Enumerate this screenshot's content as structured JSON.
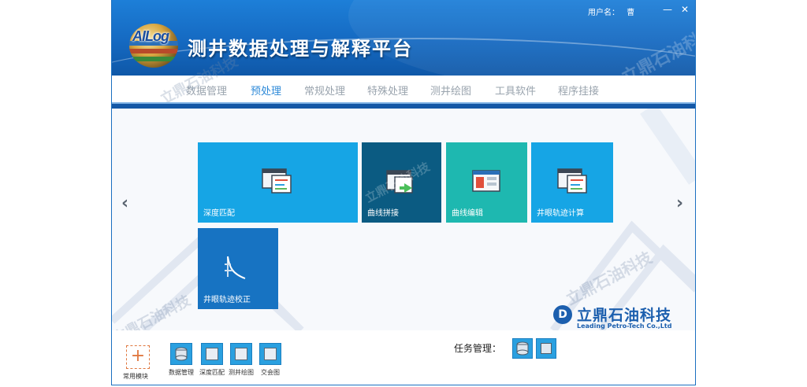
{
  "window": {
    "app_title": "测井数据处理与解释平台",
    "logo_text": "AILog",
    "user_label": "用户名：",
    "user_name": "曹",
    "minimize_label": "—",
    "close_label": "✕"
  },
  "watermark": {
    "text": "立鼎石油科技"
  },
  "menu": {
    "items": [
      {
        "label": "数据管理",
        "active": false
      },
      {
        "label": "预处理",
        "active": true
      },
      {
        "label": "常规处理",
        "active": false
      },
      {
        "label": "特殊处理",
        "active": false
      },
      {
        "label": "测井绘图",
        "active": false
      },
      {
        "label": "工具软件",
        "active": false
      },
      {
        "label": "程序挂接",
        "active": false
      }
    ]
  },
  "tiles": [
    {
      "label": "深度匹配",
      "color": "#16a5e5",
      "icon": "software-windows-icon"
    },
    {
      "label": "曲线拼接",
      "color": "#0b5b82",
      "icon": "software-windows-arrow-icon"
    },
    {
      "label": "曲线编辑",
      "color": "#1eb8b0",
      "icon": "software-window-edit-icon"
    },
    {
      "label": "井眼轨迹计算",
      "color": "#16a5e5",
      "icon": "software-windows-icon"
    },
    {
      "label": "井眼轨迹校正",
      "color": "#1773c2",
      "icon": "trajectory-curve-icon"
    }
  ],
  "nav": {
    "prev": "‹",
    "next": "›"
  },
  "brand": {
    "name_cn": "立鼎石油科技",
    "name_en": "Leading Petro-Tech Co.,Ltd",
    "mark": "D",
    "color": "#1c5fae"
  },
  "bottom": {
    "add_label": "+",
    "add_caption": "常用模块",
    "shortcuts": [
      {
        "label": "数据管理",
        "icon": "database-icon"
      },
      {
        "label": "深度匹配",
        "icon": "depth-match-icon"
      },
      {
        "label": "测井绘图",
        "icon": "well-plot-icon"
      },
      {
        "label": "交会图",
        "icon": "crossplot-icon"
      }
    ],
    "task_label": "任务管理：",
    "task_icons": [
      "database-icon",
      "map-icon"
    ]
  }
}
